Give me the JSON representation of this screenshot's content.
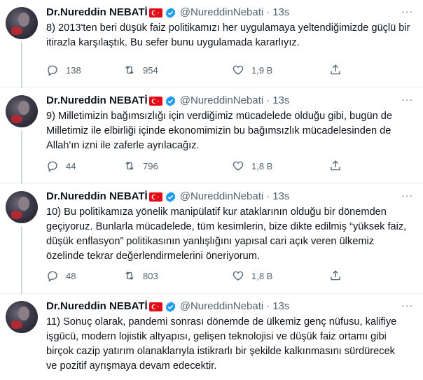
{
  "tweets": [
    {
      "name": "Dr.Nureddin NEBATİ",
      "handle": "@NureddinNebati",
      "time": "13s",
      "text": "8) 2013'ten beri düşük faiz politikamızı her uygulamaya yeltendiğimizde güçlü bir itirazla karşılaştık. Bu sefer bunu uygulamada kararlıyız.",
      "replies": "138",
      "retweets": "954",
      "likes": "1,9 B"
    },
    {
      "name": "Dr.Nureddin NEBATİ",
      "handle": "@NureddinNebati",
      "time": "13s",
      "text": "9) Milletimizin bağımsızlığı için verdiğimiz mücadelede olduğu gibi, bugün de Milletimiz ile elbirliği içinde ekonomimizin bu bağımsızlık mücadelesinden de Allah'ın izni ile zaferle ayrılacağız.",
      "replies": "44",
      "retweets": "796",
      "likes": "1,8 B"
    },
    {
      "name": "Dr.Nureddin NEBATİ",
      "handle": "@NureddinNebati",
      "time": "13s",
      "text": "10) Bu politikamıza yönelik manipülatif kur ataklarının olduğu bir dönemden geçiyoruz. Bunlarla mücadelede, tüm kesimlerin, bize dikte edilmiş “yüksek faiz, düşük enflasyon” politikasının yanlışlığını yapısal cari açık veren ülkemiz özelinde tekrar değerlendirmelerini öneriyorum.",
      "replies": "48",
      "retweets": "803",
      "likes": "1,8 B"
    },
    {
      "name": "Dr.Nureddin NEBATİ",
      "handle": "@NureddinNebati",
      "time": "13s",
      "text": "11) Sonuç olarak, pandemi sonrası dönemde de ülkemiz genç nüfusu, kalifiye işgücü, modern lojistik altyapısı,  gelişen teknolojisi ve düşük faiz ortamı gibi birçok cazip yatırım olanaklarıyla istikrarlı bir şekilde kalkınmasını sürdürecek ve pozitif ayrışmaya devam edecektir."
    }
  ],
  "ui": {
    "separator": "·",
    "more_label": "···"
  },
  "colors": {
    "text": "#0f1419",
    "secondary": "#536471",
    "verified": "#1d9bf0",
    "flag": "#e30a17",
    "thread_line": "#cfd9de"
  }
}
